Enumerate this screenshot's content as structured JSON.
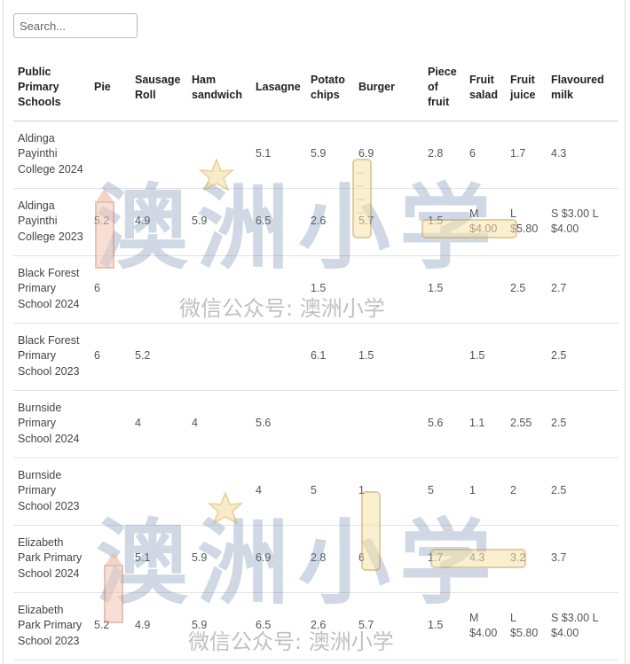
{
  "search": {
    "placeholder": "Search..."
  },
  "table": {
    "headers": [
      "Public Primary Schools",
      "Pie",
      "Sausage Roll",
      "Ham sandwich",
      "Lasagne",
      "Potato chips",
      "Burger",
      "Piece of fruit",
      "Fruit salad",
      "Fruit juice",
      "Flavoured milk"
    ],
    "rows": [
      [
        "Aldinga Payinthi College 2024",
        "",
        "",
        "",
        "5.1",
        "5.9",
        "6.9",
        "2.8",
        "6",
        "1.7",
        "4.3"
      ],
      [
        "Aldinga Payinthi College 2023",
        "5.2",
        "4.9",
        "5.9",
        "6.5",
        "2.6",
        "5.7",
        "1.5",
        "M $4.00",
        "L $5.80",
        "S $3.00 L $4.00"
      ],
      [
        "Black Forest Primary School 2024",
        "6",
        "",
        "",
        "",
        "1.5",
        "",
        "1.5",
        "",
        "2.5",
        "2.7"
      ],
      [
        "Black Forest Primary School 2023",
        "6",
        "5.2",
        "",
        "",
        "6.1",
        "1.5",
        "",
        "1.5",
        "",
        "2.5"
      ],
      [
        "Burnside Primary School 2024",
        "",
        "4",
        "4",
        "5.6",
        "",
        "",
        "5.6",
        "1.1",
        "2.55",
        "2.5"
      ],
      [
        "Burnside Primary School 2023",
        "",
        "",
        "",
        "4",
        "5",
        "1",
        "5",
        "1",
        "2",
        "2.5"
      ],
      [
        "Elizabeth Park Primary School 2024",
        "",
        "5.1",
        "5.9",
        "6.9",
        "2.8",
        "6",
        "1.7",
        "4.3",
        "3.2",
        "3.7"
      ],
      [
        "Elizabeth Park Primary School 2023",
        "5.2",
        "4.9",
        "5.9",
        "6.5",
        "2.6",
        "5.7",
        "1.5",
        "M $4.00",
        "L $5.80",
        "S $3.00 L $4.00"
      ]
    ]
  },
  "watermark": {
    "big": "澳洲小学",
    "small": "微信公众号: 澳洲小学"
  },
  "colors": {
    "header_border": "#d0d0d0",
    "row_border": "#e2e2e2",
    "watermark": "#5f7da5"
  }
}
